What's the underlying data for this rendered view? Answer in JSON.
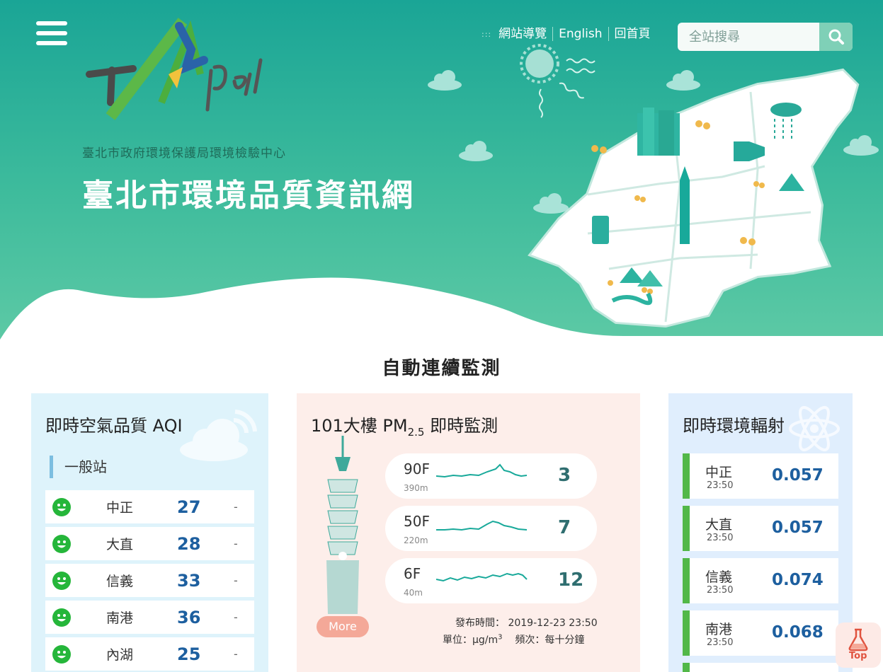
{
  "header": {
    "org_name": "臺北市政府環境保護局環境檢驗中心",
    "site_title": "臺北市環境品質資訊網",
    "logo_text": "TAipei",
    "nav": {
      "dots": ":::",
      "sitemap": "網站導覽",
      "english": "English",
      "home": "回首頁"
    },
    "search": {
      "placeholder": "全站搜尋"
    }
  },
  "section_title": "自動連續監測",
  "aqi_card": {
    "title": "即時空氣品質 AQI",
    "station_type": "一般站",
    "rows": [
      {
        "name": "中正",
        "value": "27",
        "trend": "-"
      },
      {
        "name": "大直",
        "value": "28",
        "trend": "-"
      },
      {
        "name": "信義",
        "value": "33",
        "trend": "-"
      },
      {
        "name": "南港",
        "value": "36",
        "trend": "-"
      },
      {
        "name": "內湖",
        "value": "25",
        "trend": "-"
      }
    ]
  },
  "pm_card": {
    "title_prefix": "101大樓 PM",
    "title_sub": "2.5",
    "title_suffix": " 即時監測",
    "rows": [
      {
        "floor": "90F",
        "height": "390m",
        "value": "3"
      },
      {
        "floor": "50F",
        "height": "220m",
        "value": "7"
      },
      {
        "floor": "6F",
        "height": "40m",
        "value": "12"
      }
    ],
    "more_label": "More",
    "publish_label": "發布時間：",
    "publish_time": "2019-12-23 23:50",
    "unit_label": "單位：",
    "unit_value": "μg/m",
    "unit_sup": "3",
    "freq_label": "頻次：",
    "freq_value": "每十分鐘"
  },
  "rad_card": {
    "title": "即時環境輻射",
    "rows": [
      {
        "name": "中正",
        "time": "23:50",
        "value": "0.057"
      },
      {
        "name": "大直",
        "time": "23:50",
        "value": "0.057"
      },
      {
        "name": "信義",
        "time": "23:50",
        "value": "0.074"
      },
      {
        "name": "南港",
        "time": "23:50",
        "value": "0.068"
      }
    ]
  },
  "top_button": "Top",
  "colors": {
    "hero_top": "#1aa596",
    "hero_bottom": "#5cc9a5",
    "aqi_good": "#25b63a",
    "value_blue": "#1d5f9f",
    "rad_bar": "#52b848",
    "more_btn": "#f4a898"
  }
}
